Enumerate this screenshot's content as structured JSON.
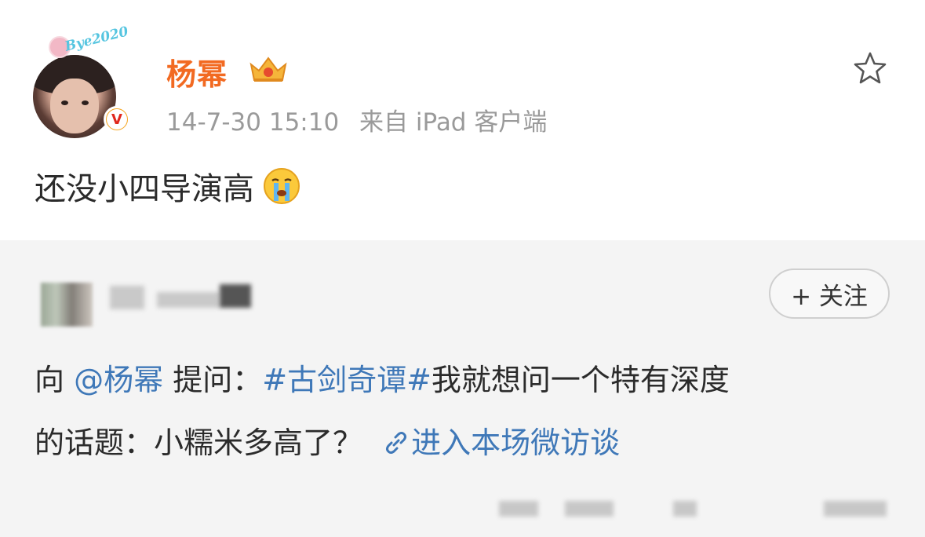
{
  "post": {
    "author": "杨幂",
    "avatar_caption": "Bye2020",
    "verified_mark": "V",
    "timestamp": "14-7-30 15:10",
    "source": "来自 iPad 客户端",
    "text": "还没小四导演高",
    "icons": [
      "crown-vip-icon",
      "star-icon",
      "crying-face-emoji"
    ]
  },
  "repost": {
    "follow_label": "+ 关注",
    "prefix": "向",
    "mention": "@杨幂",
    "ask_label": "提问：",
    "hashtag": "#古剑奇谭#",
    "question_line1": "我就想问一个特有深度",
    "question_line2": "的话题：小糯米多高了？",
    "link_text": "进入本场微访谈",
    "icons": [
      "link-icon"
    ]
  },
  "colors": {
    "username": "#f26a22",
    "meta": "#9a9a9a",
    "link": "#3f78b8",
    "repost_background": "#f4f4f4"
  }
}
